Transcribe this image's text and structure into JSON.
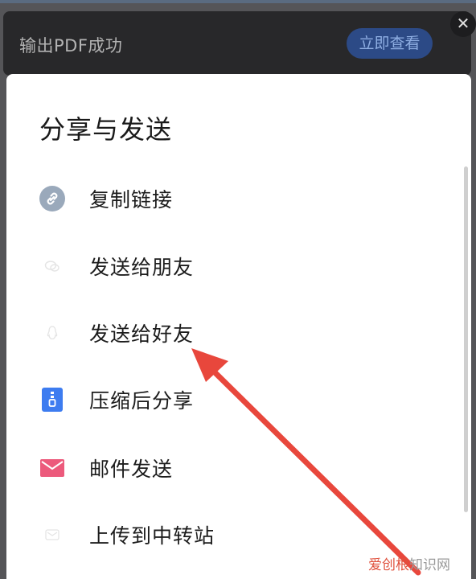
{
  "toast": {
    "message": "输出PDF成功",
    "action_label": "立即查看",
    "close_glyph": "✕"
  },
  "share_sheet": {
    "title": "分享与发送",
    "items": [
      {
        "label": "复制链接",
        "icon": "link-icon"
      },
      {
        "label": "发送给朋友",
        "icon": "wechat-icon"
      },
      {
        "label": "发送给好友",
        "icon": "qq-icon"
      },
      {
        "label": "压缩后分享",
        "icon": "zip-icon"
      },
      {
        "label": "邮件发送",
        "icon": "mail-icon"
      },
      {
        "label": "上传到中转站",
        "icon": "transfer-icon"
      }
    ]
  },
  "watermark": {
    "brand": "爱创根",
    "suffix": "知识网"
  },
  "colors": {
    "toast_bg": "#28282a",
    "toast_button_bg": "#2c4a86",
    "annotation_arrow": "#e8473c",
    "zip_icon": "#3d7cf0",
    "mail_icon": "#ec5a7c",
    "link_icon": "#9aa9bb"
  }
}
